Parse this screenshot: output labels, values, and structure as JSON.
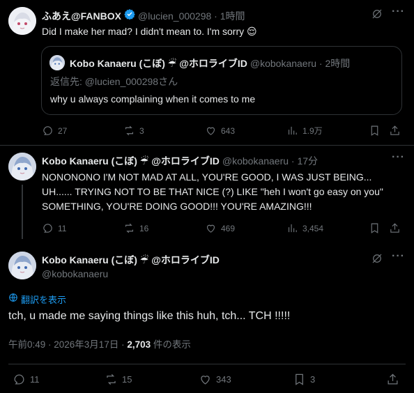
{
  "tweet1": {
    "display_name": "ふあえ@FANBOX",
    "handle_time": "@lucien_000298 · 1時間",
    "text": "Did I make her mad? I didn't mean to. I'm sorry 😌",
    "quote": {
      "name": "Kobo Kanaeru (こぼ) ☔ @ホロライブID",
      "handle_time": "@kobokanaeru · 2時間",
      "reply_to": "返信先: @lucien_000298さん",
      "text": "why u always complaining when it comes to me"
    },
    "actions": {
      "replies": "27",
      "reposts": "3",
      "likes": "643",
      "views": "1.9万"
    }
  },
  "tweet2": {
    "display_name": "Kobo Kanaeru (こぼ) ☔ @ホロライブID",
    "handle_time": "@kobokanaeru · 17分",
    "lines": [
      "NONONONO I'M NOT MAD AT ALL, YOU'RE GOOD, I WAS JUST BEING...",
      "UH...... TRYING NOT TO BE THAT NICE (?) LIKE \"heh I won't go easy on you\"",
      "SOMETHING, YOU'RE DOING GOOD!!! YOU'RE AMAZING!!!"
    ],
    "actions": {
      "replies": "11",
      "reposts": "16",
      "likes": "469",
      "views": "3,454"
    }
  },
  "tweet3": {
    "display_name": "Kobo Kanaeru (こぼ) ☔ @ホロライブID",
    "handle": "@kobokanaeru",
    "translate": "翻訳を表示",
    "text": "tch, u made me saying things like this huh, tch... TCH !!!!!",
    "timestamp": "午前0:49 · 2026年3月17日 · ",
    "views_count": "2,703",
    "views_label": " 件の表示",
    "actions": {
      "replies": "11",
      "reposts": "15",
      "likes": "343",
      "bookmarks": "3"
    }
  },
  "colors": {
    "background": "#000000",
    "text": "#e7e9ea",
    "muted": "#71767b",
    "verified": "#1d9bf0",
    "translate": "#1d9bf0"
  }
}
